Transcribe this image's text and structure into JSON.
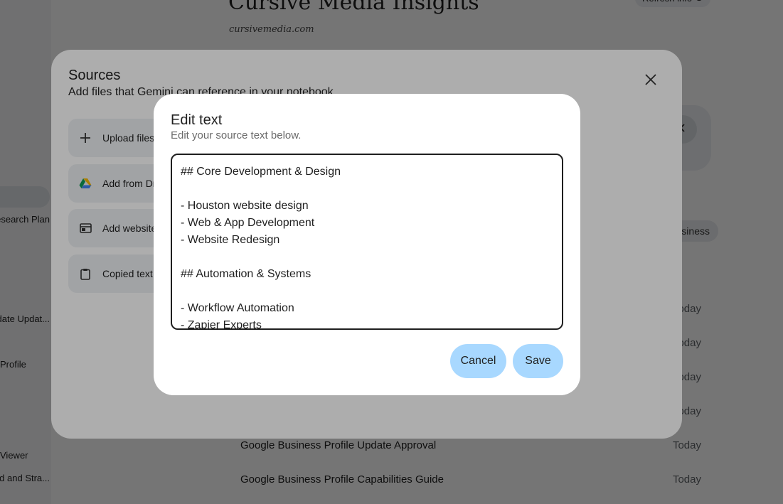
{
  "background": {
    "notebook_title": "Cursive Media Insights",
    "domain": "cursivemedia.com",
    "refresh_label": "Refresh info",
    "chip_label": "Business",
    "sidebar_items": [
      "Research Plan",
      "Update Updat...",
      "Profile",
      "Viewer",
      "Brand and Stra..."
    ],
    "source_rows": [
      {
        "title": "Google Business Profile Update Approval",
        "date": "Today"
      },
      {
        "title": "Google Business Profile Capabilities Guide",
        "date": "Today"
      }
    ],
    "partial_dates": [
      "Today",
      "Today",
      "Today",
      "Today"
    ]
  },
  "sources_dialog": {
    "title": "Sources",
    "subtitle": "Add files that Gemini can reference in your notebook",
    "buttons": [
      {
        "label": "Upload files",
        "icon": "plus-icon"
      },
      {
        "label": "Add from Drive",
        "icon": "google-drive-icon"
      },
      {
        "label": "Add websites",
        "icon": "web-icon"
      },
      {
        "label": "Copied text",
        "icon": "clipboard-icon"
      }
    ]
  },
  "edit_dialog": {
    "title": "Edit text",
    "subtitle": "Edit your source text below.",
    "lines": [
      "## Core Development & Design",
      "",
      "- Houston website design",
      "- Web & App Development",
      "- Website Redesign",
      "",
      "## Automation & Systems",
      "",
      "- Workflow Automation",
      "- Zapier Experts"
    ],
    "cancel_label": "Cancel",
    "save_label": "Save"
  },
  "colors": {
    "button_fill": "#a8d8ff",
    "scrim": "rgba(0,0,0,0.32)"
  }
}
